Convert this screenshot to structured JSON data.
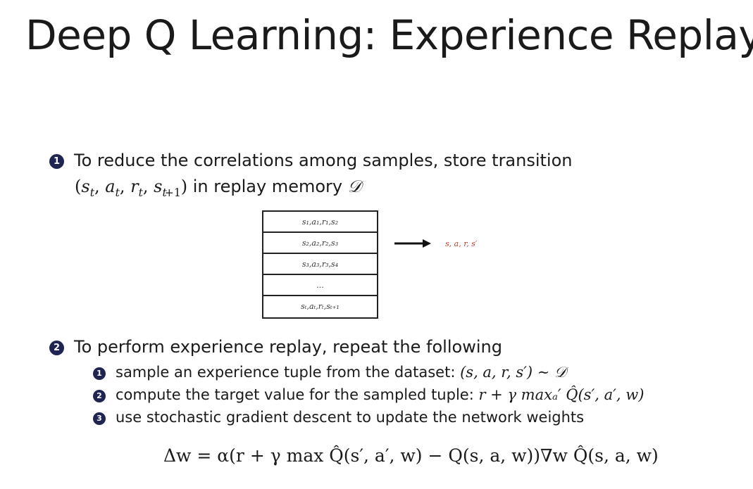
{
  "slide": {
    "title": "Deep Q Learning: Experience Replay"
  },
  "point1": {
    "badge": "1",
    "line1": "To reduce the correlations among samples, store transition",
    "line2_text": " in replay memory ",
    "memory_symbol": "𝒟"
  },
  "replay_table": {
    "rows": [
      "s₁,a₁,r₁,s₂",
      "s₂,a₂,r₂,s₃",
      "s₃,a₃,r₃,s₄",
      "...",
      "sₜ,aₜ,rₜ,sₜ₊₁"
    ],
    "output_label": "s, a, r, s′"
  },
  "point2": {
    "badge": "2",
    "text": "To perform experience replay, repeat the following",
    "substeps": [
      {
        "badge": "1",
        "text": "sample an experience tuple from the dataset: ",
        "math": "(s, a, r, s′) ∼ 𝒟"
      },
      {
        "badge": "2",
        "text": "compute the target value for the sampled tuple: ",
        "math": "r + γ maxₐ′ Q̂(s′, a′, w)"
      },
      {
        "badge": "3",
        "text": "use stochastic gradient descent to update the network weights",
        "math": ""
      }
    ]
  },
  "update_rule": "Δw = α(r + γ max Q̂(s′, a′, w) − Q(s, a, w))∇w Q̂(s, a, w)"
}
